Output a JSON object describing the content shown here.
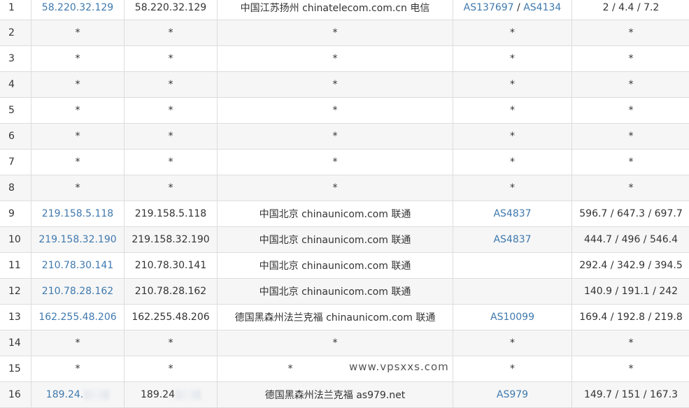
{
  "rows": [
    {
      "hop": "1",
      "ip": "58.220.32.129",
      "host": "58.220.32.129",
      "location": "中国江苏扬州 chinatelecom.com.cn 电信",
      "as1": "AS137697",
      "as_sep": " / ",
      "as2": "AS4134",
      "time": "2 / 4.4 / 7.2"
    },
    {
      "hop": "2",
      "ip": "*",
      "host": "*",
      "location": "*",
      "as1": "*",
      "as_sep": "",
      "as2": "",
      "time": "*"
    },
    {
      "hop": "3",
      "ip": "*",
      "host": "*",
      "location": "*",
      "as1": "*",
      "as_sep": "",
      "as2": "",
      "time": "*"
    },
    {
      "hop": "4",
      "ip": "*",
      "host": "*",
      "location": "*",
      "as1": "*",
      "as_sep": "",
      "as2": "",
      "time": "*"
    },
    {
      "hop": "5",
      "ip": "*",
      "host": "*",
      "location": "*",
      "as1": "*",
      "as_sep": "",
      "as2": "",
      "time": "*"
    },
    {
      "hop": "6",
      "ip": "*",
      "host": "*",
      "location": "*",
      "as1": "*",
      "as_sep": "",
      "as2": "",
      "time": "*"
    },
    {
      "hop": "7",
      "ip": "*",
      "host": "*",
      "location": "*",
      "as1": "*",
      "as_sep": "",
      "as2": "",
      "time": "*"
    },
    {
      "hop": "8",
      "ip": "*",
      "host": "*",
      "location": "*",
      "as1": "*",
      "as_sep": "",
      "as2": "",
      "time": "*"
    },
    {
      "hop": "9",
      "ip": "219.158.5.118",
      "host": "219.158.5.118",
      "location": "中国北京 chinaunicom.com 联通",
      "as1": "AS4837",
      "as_sep": "",
      "as2": "",
      "time": "596.7 / 647.3 / 697.7"
    },
    {
      "hop": "10",
      "ip": "219.158.32.190",
      "host": "219.158.32.190",
      "location": "中国北京 chinaunicom.com 联通",
      "as1": "AS4837",
      "as_sep": "",
      "as2": "",
      "time": "444.7 / 496 / 546.4"
    },
    {
      "hop": "11",
      "ip": "210.78.30.141",
      "host": "210.78.30.141",
      "location": "中国北京 chinaunicom.com 联通",
      "as1": "",
      "as_sep": "",
      "as2": "",
      "time": "292.4 / 342.9 / 394.5"
    },
    {
      "hop": "12",
      "ip": "210.78.28.162",
      "host": "210.78.28.162",
      "location": "中国北京 chinaunicom.com 联通",
      "as1": "",
      "as_sep": "",
      "as2": "",
      "time": "140.9 / 191.1 / 242"
    },
    {
      "hop": "13",
      "ip": "162.255.48.206",
      "host": "162.255.48.206",
      "location": "德国黑森州法兰克福 chinaunicom.com 联通",
      "as1": "AS10099",
      "as_sep": "",
      "as2": "",
      "time": "169.4 / 192.8 / 219.8"
    },
    {
      "hop": "14",
      "ip": "*",
      "host": "*",
      "location": "*",
      "as1": "*",
      "as_sep": "",
      "as2": "",
      "time": "*"
    },
    {
      "hop": "15",
      "ip": "*",
      "host": "*",
      "location": "*",
      "as1": "*",
      "as_sep": "",
      "as2": "",
      "time": "*"
    },
    {
      "hop": "16",
      "ip": "189.24.",
      "host": "189.24",
      "location": "德国黑森州法兰克福 as979.net",
      "as1": "AS979",
      "as_sep": "",
      "as2": "",
      "time": "149.7 / 151 / 167.3"
    }
  ],
  "watermark": "www.vpsxxs.com",
  "colors": {
    "link": "#3f79ae",
    "text": "#333333",
    "border": "#dddddd",
    "row_alt": "#f6f6f6"
  }
}
